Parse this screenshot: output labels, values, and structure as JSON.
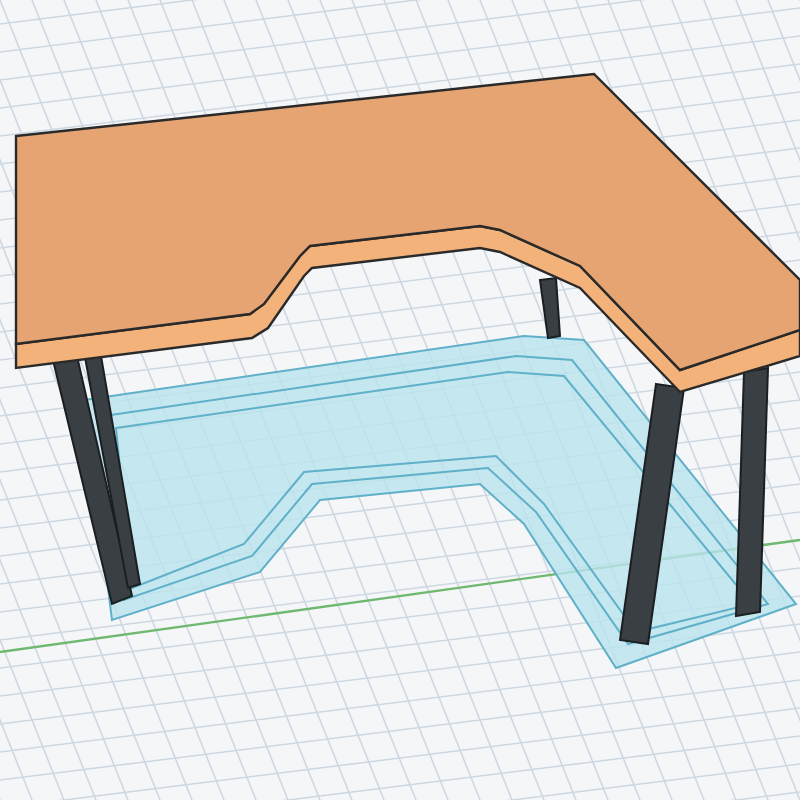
{
  "viewport": {
    "kind": "perspective",
    "grid": true,
    "axis": true,
    "footprint": true
  }
}
